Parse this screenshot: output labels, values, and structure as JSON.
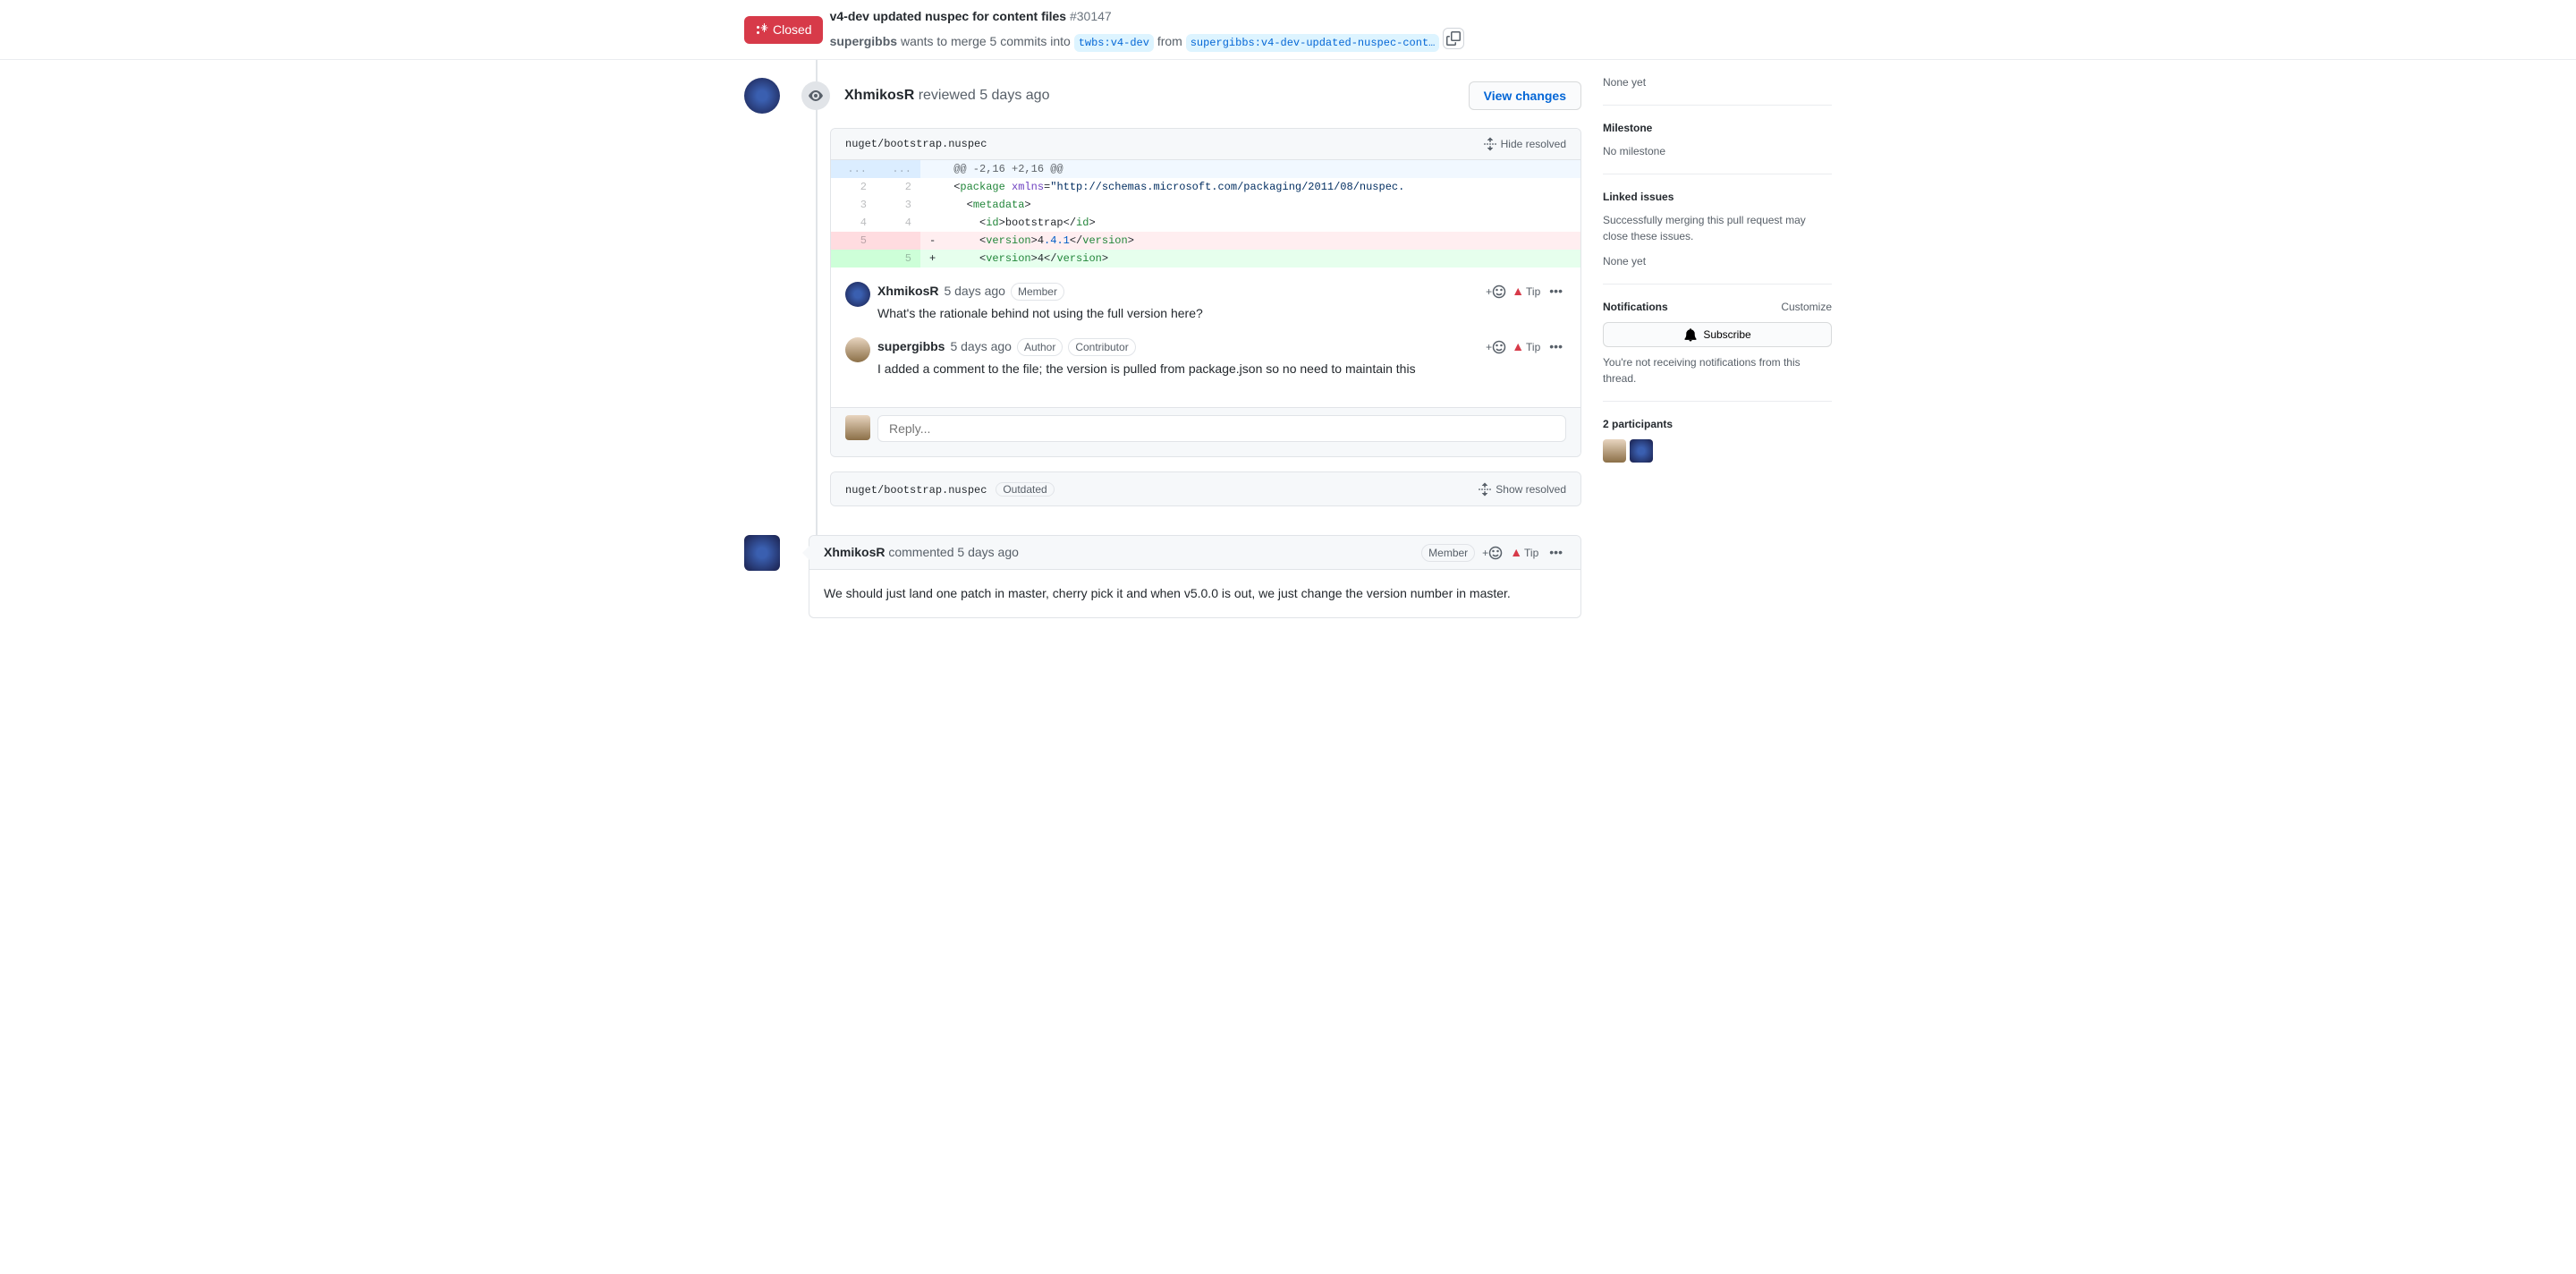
{
  "header": {
    "state": "Closed",
    "title": "v4-dev updated nuspec for content files",
    "number": "#30147",
    "author": "supergibbs",
    "mergeText1": "wants to merge 5 commits into",
    "baseBranch": "twbs:v4-dev",
    "fromText": "from",
    "headBranch": "supergibbs:v4-dev-updated-nuspec-cont…"
  },
  "review": {
    "reviewer": "XhmikosR",
    "action": "reviewed",
    "time": "5 days ago",
    "viewChanges": "View changes",
    "filePath": "nuget/bootstrap.nuspec",
    "hideResolved": "Hide resolved",
    "hunkHeader": "@@ -2,16 +2,16 @@",
    "diff": {
      "line2": {
        "oldNum": "2",
        "newNum": "2",
        "content": "<package xmlns=\"http://schemas.microsoft.com/packaging/2011/08/nuspec."
      },
      "line3": {
        "oldNum": "3",
        "newNum": "3",
        "content": "  <metadata>"
      },
      "line4": {
        "oldNum": "4",
        "newNum": "4",
        "content": "    <id>bootstrap</id>"
      },
      "line5del": {
        "oldNum": "5",
        "content": "    <version>4.4.1</version>"
      },
      "line5add": {
        "newNum": "5",
        "content": "    <version>4</version>"
      }
    },
    "comments": [
      {
        "author": "XhmikosR",
        "time": "5 days ago",
        "badges": [
          "Member"
        ],
        "text": "What's the rationale behind not using the full version here?"
      },
      {
        "author": "supergibbs",
        "time": "5 days ago",
        "badges": [
          "Author",
          "Contributor"
        ],
        "text": "I added a comment to the file; the version is pulled from package.json so no need to maintain this"
      }
    ],
    "replyPlaceholder": "Reply...",
    "outdated": {
      "filePath": "nuget/bootstrap.nuspec",
      "label": "Outdated",
      "showResolved": "Show resolved"
    }
  },
  "mainComment": {
    "author": "XhmikosR",
    "action": "commented",
    "time": "5 days ago",
    "badge": "Member",
    "text": "We should just land one patch in master, cherry pick it and when v5.0.0 is out, we just change the version number in master."
  },
  "sidebar": {
    "noneYet": "None yet",
    "milestone": {
      "title": "Milestone",
      "text": "No milestone"
    },
    "linkedIssues": {
      "title": "Linked issues",
      "text": "Successfully merging this pull request may close these issues.",
      "none": "None yet"
    },
    "notifications": {
      "title": "Notifications",
      "customize": "Customize",
      "subscribe": "Subscribe",
      "note": "You're not receiving notifications from this thread."
    },
    "participants": {
      "title": "2 participants"
    }
  },
  "labels": {
    "tip": "Tip"
  }
}
